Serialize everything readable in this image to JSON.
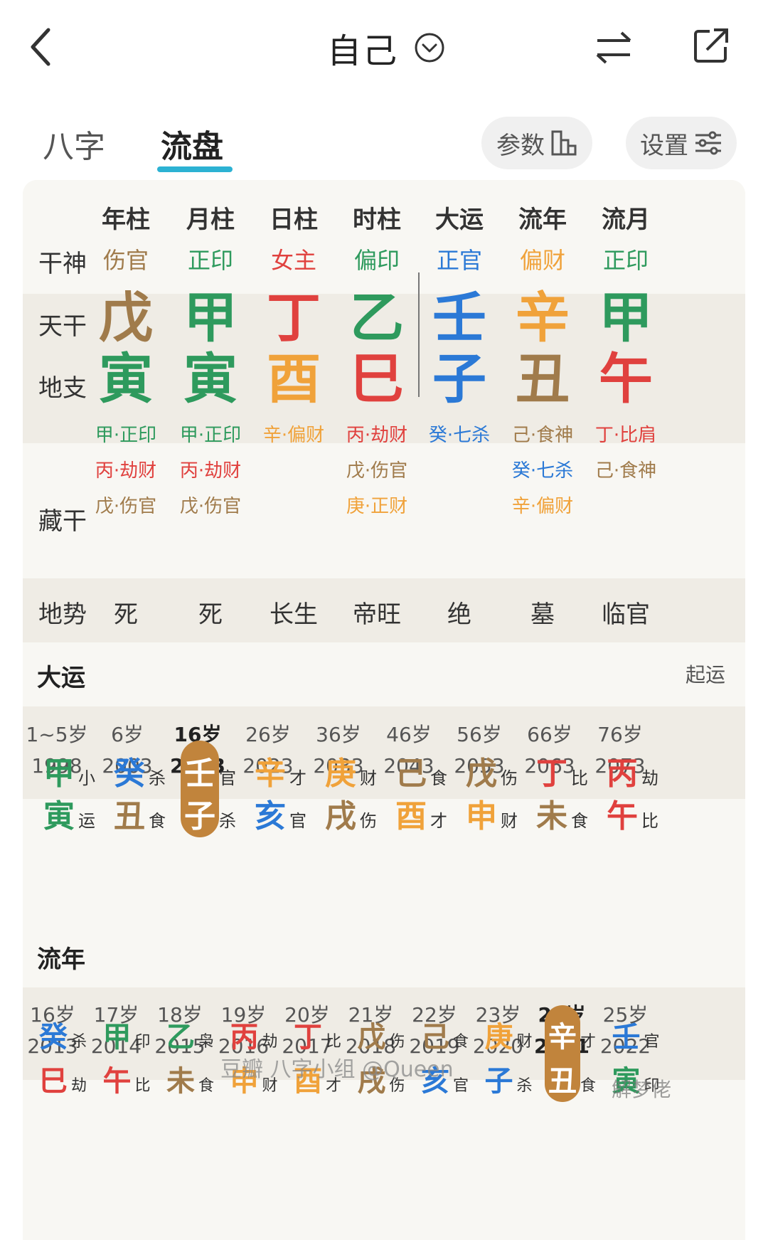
{
  "header": {
    "title": "自己"
  },
  "tabs": [
    "八字",
    "流盘"
  ],
  "pills": {
    "params": "参数",
    "settings": "设置"
  },
  "columns": [
    "年柱",
    "月柱",
    "日柱",
    "时柱",
    "大运",
    "流年",
    "流月"
  ],
  "labels": {
    "ganshen": "干神",
    "tiangan": "天干",
    "dizhi": "地支",
    "canggan": "藏干",
    "dishi": "地势"
  },
  "colors": {
    "green": "#2e9a5d",
    "red": "#e0413e",
    "orange": "#f0a23a",
    "brown": "#a07b4b",
    "blue": "#2b79d6",
    "accent": "#2cb2d3",
    "selected": "#c1843c"
  },
  "ganshen": [
    {
      "t": "伤官",
      "c": "brown"
    },
    {
      "t": "正印",
      "c": "green"
    },
    {
      "t": "女主",
      "c": "red"
    },
    {
      "t": "偏印",
      "c": "green"
    },
    {
      "t": "正官",
      "c": "blue"
    },
    {
      "t": "偏财",
      "c": "orange"
    },
    {
      "t": "正印",
      "c": "green"
    }
  ],
  "tiangan": [
    {
      "t": "戊",
      "c": "brown"
    },
    {
      "t": "甲",
      "c": "green"
    },
    {
      "t": "丁",
      "c": "red"
    },
    {
      "t": "乙",
      "c": "green"
    },
    {
      "t": "壬",
      "c": "blue"
    },
    {
      "t": "辛",
      "c": "orange"
    },
    {
      "t": "甲",
      "c": "green"
    }
  ],
  "dizhi": [
    {
      "t": "寅",
      "c": "green"
    },
    {
      "t": "寅",
      "c": "green"
    },
    {
      "t": "酉",
      "c": "orange"
    },
    {
      "t": "巳",
      "c": "red"
    },
    {
      "t": "子",
      "c": "blue"
    },
    {
      "t": "丑",
      "c": "brown"
    },
    {
      "t": "午",
      "c": "red"
    }
  ],
  "canggan": [
    [
      {
        "t": "甲·正印",
        "c": "green"
      },
      {
        "t": "丙·劫财",
        "c": "red"
      },
      {
        "t": "戊·伤官",
        "c": "brown"
      }
    ],
    [
      {
        "t": "甲·正印",
        "c": "green"
      },
      {
        "t": "丙·劫财",
        "c": "red"
      },
      {
        "t": "戊·伤官",
        "c": "brown"
      }
    ],
    [
      {
        "t": "辛·偏财",
        "c": "orange"
      }
    ],
    [
      {
        "t": "丙·劫财",
        "c": "red"
      },
      {
        "t": "戊·伤官",
        "c": "brown"
      },
      {
        "t": "庚·正财",
        "c": "orange"
      }
    ],
    [
      {
        "t": "癸·七杀",
        "c": "blue"
      }
    ],
    [
      {
        "t": "己·食神",
        "c": "brown"
      },
      {
        "t": "癸·七杀",
        "c": "blue"
      },
      {
        "t": "辛·偏财",
        "c": "orange"
      }
    ],
    [
      {
        "t": "丁·比肩",
        "c": "red"
      },
      {
        "t": "己·食神",
        "c": "brown"
      }
    ]
  ],
  "dishi": [
    "死",
    "死",
    "长生",
    "帝旺",
    "绝",
    "墓",
    "临官"
  ],
  "dayun": {
    "title": "大运",
    "action": "起运",
    "ages": [
      {
        "a": "1~5岁",
        "y": "1998"
      },
      {
        "a": "6岁",
        "y": "2003"
      },
      {
        "a": "16岁",
        "y": "2013",
        "bold": true
      },
      {
        "a": "26岁",
        "y": "2023"
      },
      {
        "a": "36岁",
        "y": "2033"
      },
      {
        "a": "46岁",
        "y": "2043"
      },
      {
        "a": "56岁",
        "y": "2053"
      },
      {
        "a": "66岁",
        "y": "2063"
      },
      {
        "a": "76岁",
        "y": "2073"
      }
    ],
    "pillars": [
      {
        "g": "甲",
        "gc": "green",
        "gs": "小",
        "z": "寅",
        "zc": "green",
        "zs": "运"
      },
      {
        "g": "癸",
        "gc": "blue",
        "gs": "杀",
        "z": "丑",
        "zc": "brown",
        "zs": "食"
      },
      {
        "g": "壬",
        "gc": "blue",
        "gs": "官",
        "z": "子",
        "zc": "blue",
        "zs": "杀",
        "sel": true
      },
      {
        "g": "辛",
        "gc": "orange",
        "gs": "才",
        "z": "亥",
        "zc": "blue",
        "zs": "官"
      },
      {
        "g": "庚",
        "gc": "orange",
        "gs": "财",
        "z": "戌",
        "zc": "brown",
        "zs": "伤"
      },
      {
        "g": "己",
        "gc": "brown",
        "gs": "食",
        "z": "酉",
        "zc": "orange",
        "zs": "才"
      },
      {
        "g": "戊",
        "gc": "brown",
        "gs": "伤",
        "z": "申",
        "zc": "orange",
        "zs": "财"
      },
      {
        "g": "丁",
        "gc": "red",
        "gs": "比",
        "z": "未",
        "zc": "brown",
        "zs": "食"
      },
      {
        "g": "丙",
        "gc": "red",
        "gs": "劫",
        "z": "午",
        "zc": "red",
        "zs": "比"
      }
    ]
  },
  "liunian": {
    "title": "流年",
    "ages": [
      {
        "a": "16岁",
        "y": "2013"
      },
      {
        "a": "17岁",
        "y": "2014"
      },
      {
        "a": "18岁",
        "y": "2015"
      },
      {
        "a": "19岁",
        "y": "2016"
      },
      {
        "a": "20岁",
        "y": "2017"
      },
      {
        "a": "21岁",
        "y": "2018"
      },
      {
        "a": "22岁",
        "y": "2019"
      },
      {
        "a": "23岁",
        "y": "2020"
      },
      {
        "a": "24岁",
        "y": "2021",
        "bold": true
      },
      {
        "a": "25岁",
        "y": "2022"
      }
    ],
    "pillars": [
      {
        "g": "癸",
        "gc": "blue",
        "gs": "杀",
        "z": "巳",
        "zc": "red",
        "zs": "劫"
      },
      {
        "g": "甲",
        "gc": "green",
        "gs": "印",
        "z": "午",
        "zc": "red",
        "zs": "比"
      },
      {
        "g": "乙",
        "gc": "green",
        "gs": "枭",
        "z": "未",
        "zc": "brown",
        "zs": "食"
      },
      {
        "g": "丙",
        "gc": "red",
        "gs": "劫",
        "z": "申",
        "zc": "orange",
        "zs": "财"
      },
      {
        "g": "丁",
        "gc": "red",
        "gs": "比",
        "z": "酉",
        "zc": "orange",
        "zs": "才"
      },
      {
        "g": "戊",
        "gc": "brown",
        "gs": "伤",
        "z": "戌",
        "zc": "brown",
        "zs": "伤"
      },
      {
        "g": "己",
        "gc": "brown",
        "gs": "食",
        "z": "亥",
        "zc": "blue",
        "zs": "官"
      },
      {
        "g": "庚",
        "gc": "orange",
        "gs": "财",
        "z": "子",
        "zc": "blue",
        "zs": "杀"
      },
      {
        "g": "辛",
        "gc": "orange",
        "gs": "才",
        "z": "丑",
        "zc": "brown",
        "zs": "食",
        "sel": true
      },
      {
        "g": "壬",
        "gc": "blue",
        "gs": "官",
        "z": "寅",
        "zc": "green",
        "zs": "印"
      }
    ]
  },
  "watermark": {
    "source": "豆瓣",
    "text": "八字小组 @Queen",
    "site": "解梦佬"
  }
}
